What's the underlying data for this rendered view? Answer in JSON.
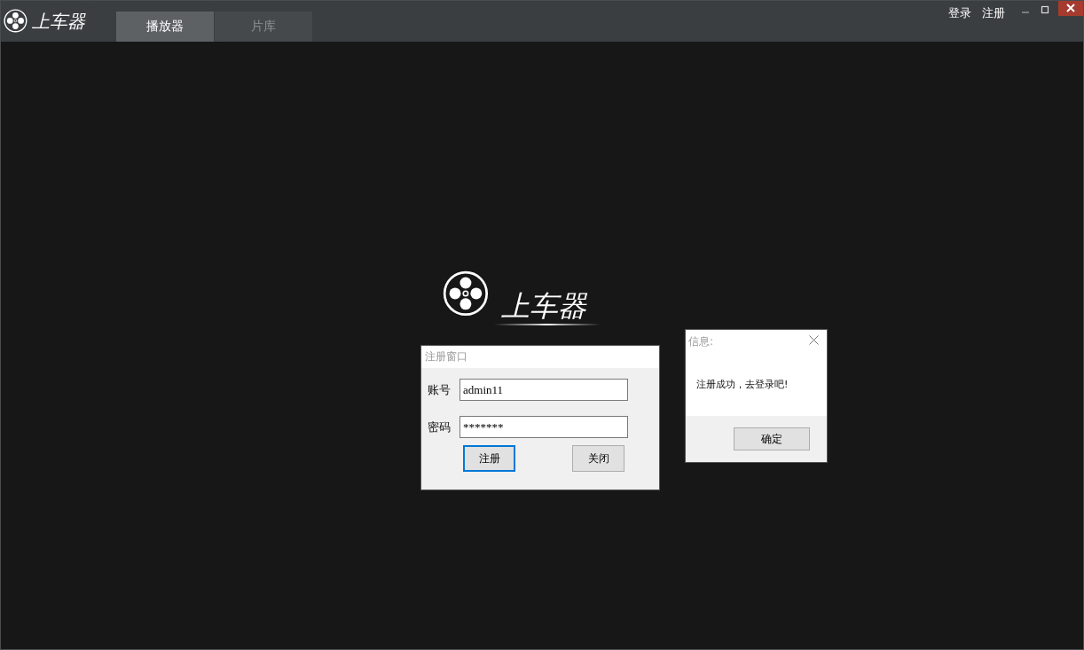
{
  "app": {
    "logo_text": "上车器"
  },
  "tabs": [
    {
      "label": "播放器",
      "selected": true
    },
    {
      "label": "片库",
      "selected": false
    }
  ],
  "header_links": [
    "登录",
    "注册"
  ],
  "splash": {
    "logo_text": "上车器"
  },
  "register_dialog": {
    "title": "注册窗口",
    "fields": [
      {
        "label": "账号",
        "value": "admin11"
      },
      {
        "label": "密码",
        "value": "*******"
      }
    ],
    "buttons": [
      {
        "label": "注册",
        "focused": true
      },
      {
        "label": "关闭",
        "focused": false
      }
    ]
  },
  "message_box": {
    "title": "信息:",
    "message": "注册成功，去登录吧!",
    "buttons": [
      "确定"
    ]
  }
}
